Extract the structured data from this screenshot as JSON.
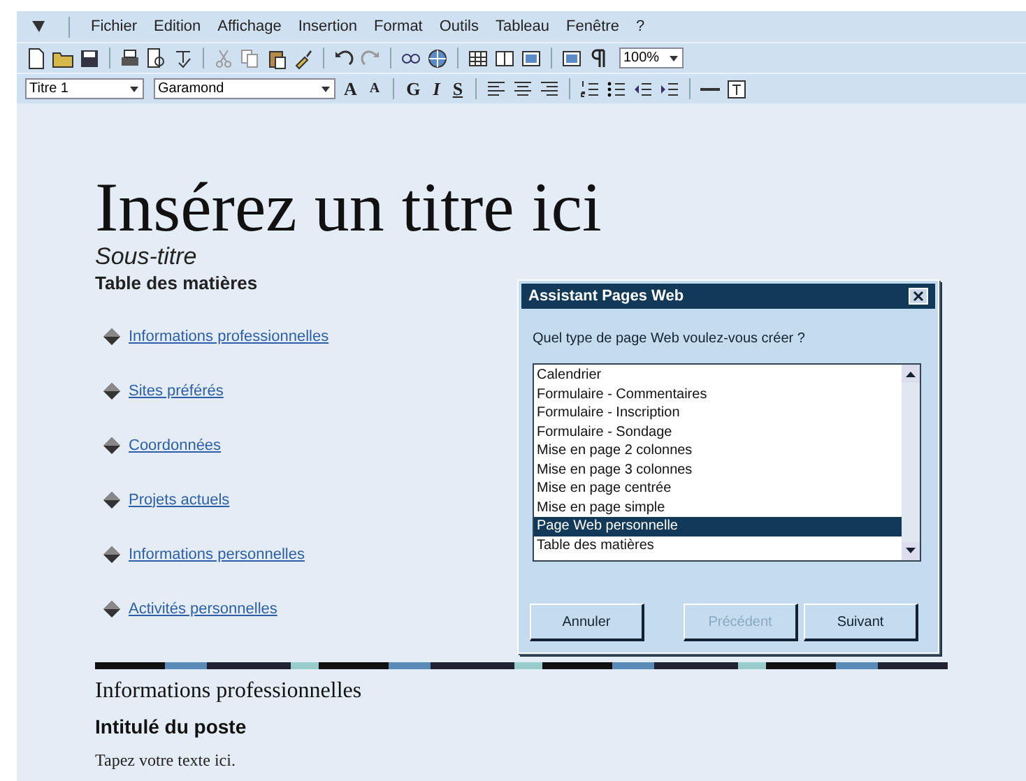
{
  "menu_bar": {
    "items": [
      "Fichier",
      "Edition",
      "Affichage",
      "Insertion",
      "Format",
      "Outils",
      "Tableau",
      "Fenêtre",
      "?"
    ]
  },
  "standard_toolbar": {
    "zoom": "100%"
  },
  "format_toolbar": {
    "style": "Titre 1",
    "font": "Garamond",
    "buttons": [
      {
        "label": "A",
        "kind": "grow"
      },
      {
        "label": "A",
        "kind": "shrink"
      },
      {
        "label": "G",
        "kind": "bold"
      },
      {
        "label": "I",
        "kind": "italic"
      },
      {
        "label": "S",
        "kind": "underline"
      }
    ]
  },
  "document": {
    "title": "Insérez un titre ici",
    "subtitle": "Sous-titre",
    "toc_heading": "Table des matières",
    "links": [
      "Informations professionnelles",
      "Sites préférés",
      "Coordonnées",
      "Projets actuels",
      "Informations personnelles",
      "Activités personnelles"
    ],
    "section_heading": "Informations professionnelles",
    "field_heading": "Intitulé du poste",
    "body_text": "Tapez votre texte ici."
  },
  "dialog": {
    "title": "Assistant Pages Web",
    "prompt": "Quel type de page Web voulez-vous créer ?",
    "options": [
      {
        "label": "Calendrier",
        "selected": false
      },
      {
        "label": "Formulaire - Commentaires",
        "selected": false
      },
      {
        "label": "Formulaire - Inscription",
        "selected": false
      },
      {
        "label": "Formulaire - Sondage",
        "selected": false
      },
      {
        "label": "Mise en page 2 colonnes",
        "selected": false
      },
      {
        "label": "Mise en page 3 colonnes",
        "selected": false
      },
      {
        "label": "Mise en page centrée",
        "selected": false
      },
      {
        "label": "Mise en page simple",
        "selected": false
      },
      {
        "label": "Page Web personnelle",
        "selected": true
      },
      {
        "label": "Table des matières",
        "selected": false
      }
    ],
    "buttons": [
      {
        "label": "Annuler",
        "disabled": false
      },
      {
        "label": "Précédent",
        "disabled": true
      },
      {
        "label": "Suivant",
        "disabled": false
      }
    ]
  }
}
